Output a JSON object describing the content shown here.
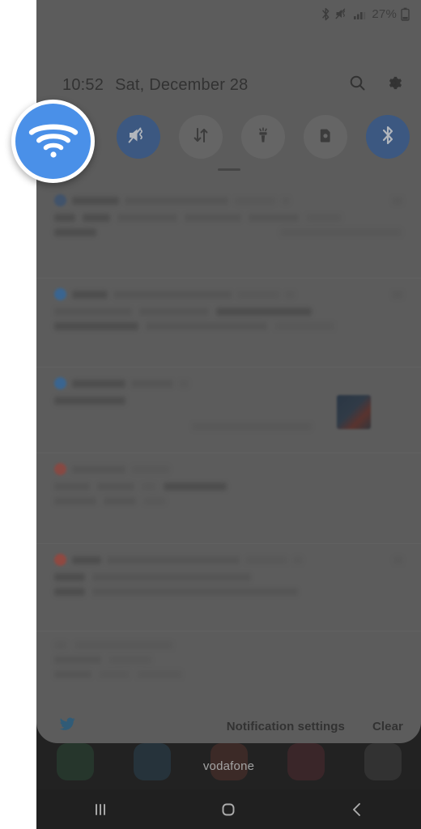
{
  "phone": {
    "status_bar": {
      "icons": [
        "bluetooth-icon",
        "mute-vibrate-icon",
        "signal-bars-icon"
      ],
      "battery_percent": "27%",
      "battery_icon": "battery-low-icon"
    },
    "quick_panel": {
      "clock": {
        "time": "10:52",
        "date": "Sat, December 28"
      },
      "header_actions": [
        {
          "name": "search-icon",
          "label": "Search"
        },
        {
          "name": "gear-icon",
          "label": "Settings"
        }
      ],
      "toggles": [
        {
          "id": "wifi",
          "label": "Wi-Fi",
          "icon": "wifi-icon",
          "state": "on",
          "highlighted": true
        },
        {
          "id": "sound",
          "label": "Mute",
          "icon": "mute-icon",
          "state": "on",
          "highlighted": false
        },
        {
          "id": "mobiledata",
          "label": "Mobile data",
          "icon": "data-arrows-icon",
          "state": "off",
          "highlighted": false
        },
        {
          "id": "flashlight",
          "label": "Flashlight",
          "icon": "flashlight-icon",
          "state": "off",
          "highlighted": false
        },
        {
          "id": "sdcard",
          "label": "Storage",
          "icon": "sdcard-icon",
          "state": "off",
          "highlighted": false
        },
        {
          "id": "bluetooth",
          "label": "Bluetooth",
          "icon": "bluetooth-icon",
          "state": "on",
          "highlighted": false
        }
      ],
      "drag_handle": "panel-drag-handle",
      "footer": {
        "app_icon": "twitter-bird-icon",
        "notification_settings_label": "Notification settings",
        "clear_label": "Clear"
      }
    },
    "notifications": [
      {
        "app_color": "#2a4c7a",
        "redacted": true
      },
      {
        "app_color": "#1d6fc0",
        "redacted": true
      },
      {
        "app_color": "#1d6fc0",
        "redacted": true,
        "has_thumbnail": true
      },
      {
        "app_color": "#b03a2e",
        "redacted": true
      },
      {
        "app_color": "#c0392b",
        "redacted": true
      },
      {
        "app_color": "#6e6e6e",
        "redacted": true
      }
    ],
    "home_screen": {
      "carrier": "vodafone",
      "dock_icons": [
        "#1c6b38",
        "#1a5c86",
        "#8a2f22",
        "#7e1f2a",
        "#5a5a5a"
      ]
    },
    "nav_bar": [
      {
        "name": "recents-button",
        "icon": "recents-icon"
      },
      {
        "name": "home-button",
        "icon": "home-icon"
      },
      {
        "name": "back-button",
        "icon": "back-icon"
      }
    ]
  },
  "callout": {
    "target": "wifi-icon",
    "label": "Wi-Fi",
    "accent_color": "#4a90e8",
    "ring_color": "#ffffff"
  }
}
